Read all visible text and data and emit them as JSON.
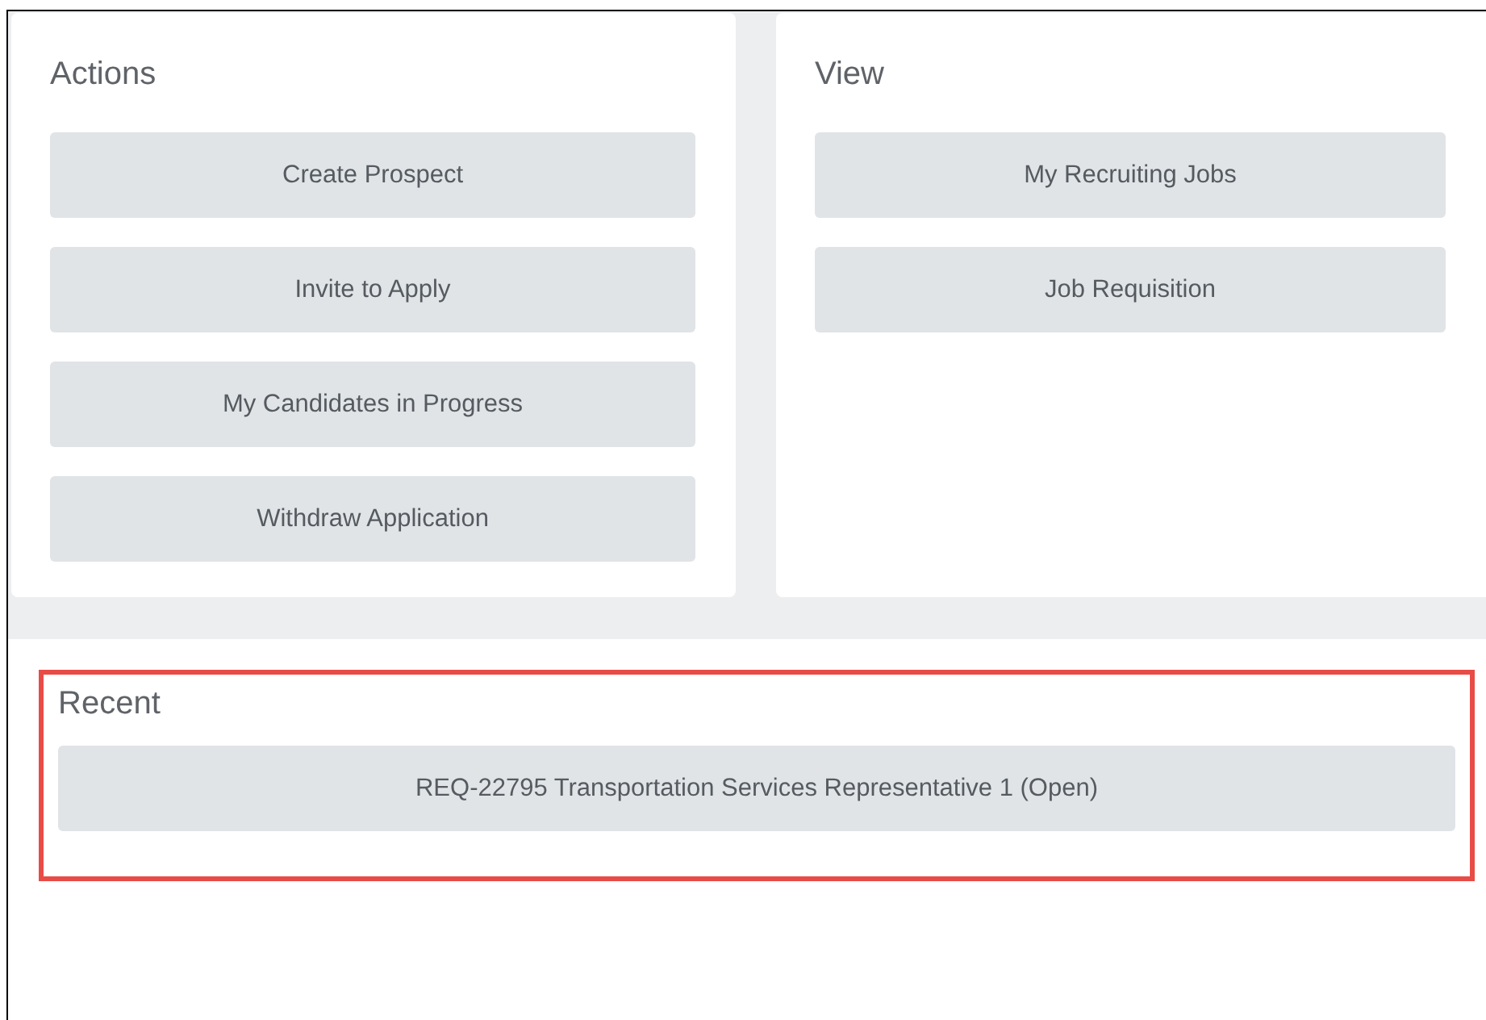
{
  "panels": [
    {
      "title": "Actions",
      "buttons": [
        "Create Prospect",
        "Invite to Apply",
        "My Candidates in Progress",
        "Withdraw Application"
      ]
    },
    {
      "title": "View",
      "buttons": [
        "My Recruiting Jobs",
        "Job Requisition"
      ]
    }
  ],
  "recent": {
    "title": "Recent",
    "highlighted": true,
    "items": [
      "REQ-22795 Transportation Services Representative 1 (Open)"
    ]
  }
}
